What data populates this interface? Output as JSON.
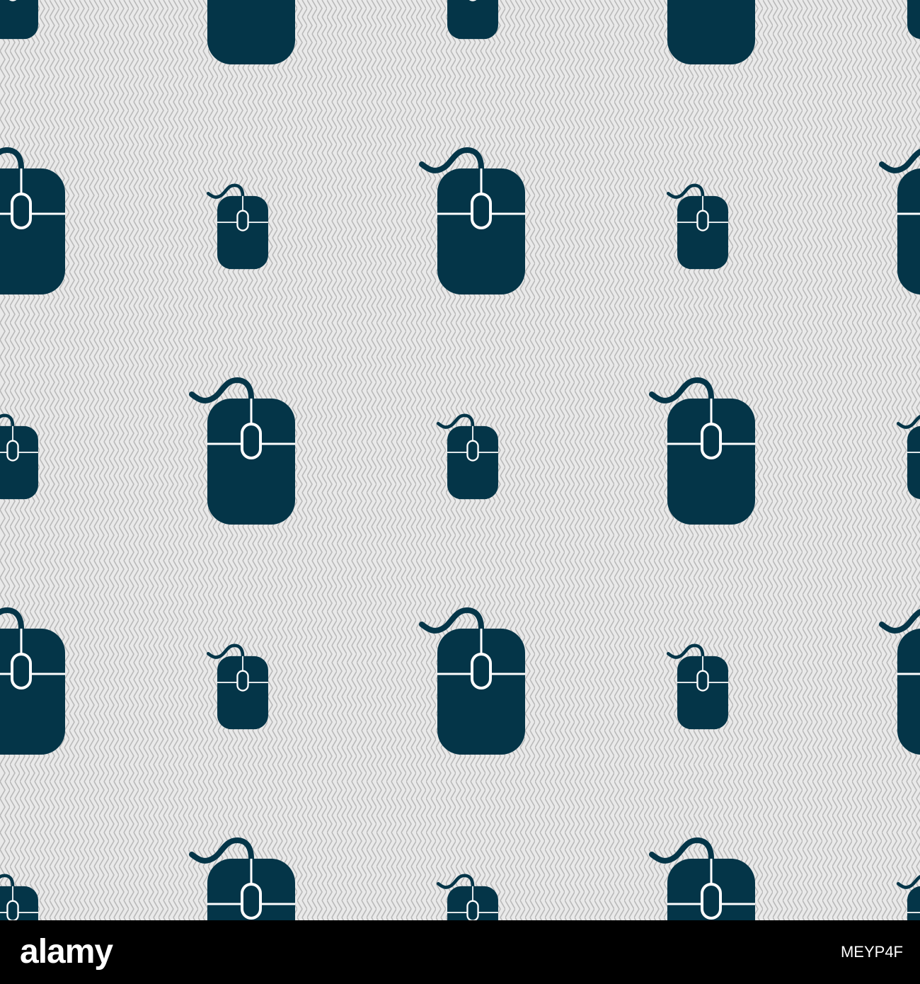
{
  "pattern": {
    "background_color": "#e9e9e9",
    "wave_color": "#b9b9b9",
    "icon_color": "#043548",
    "detail_color": "#ffffff",
    "icon": "computer-mouse-icon"
  },
  "footer": {
    "background_color": "#000000",
    "brand": "alamy",
    "image_id": "MEYP4F"
  }
}
